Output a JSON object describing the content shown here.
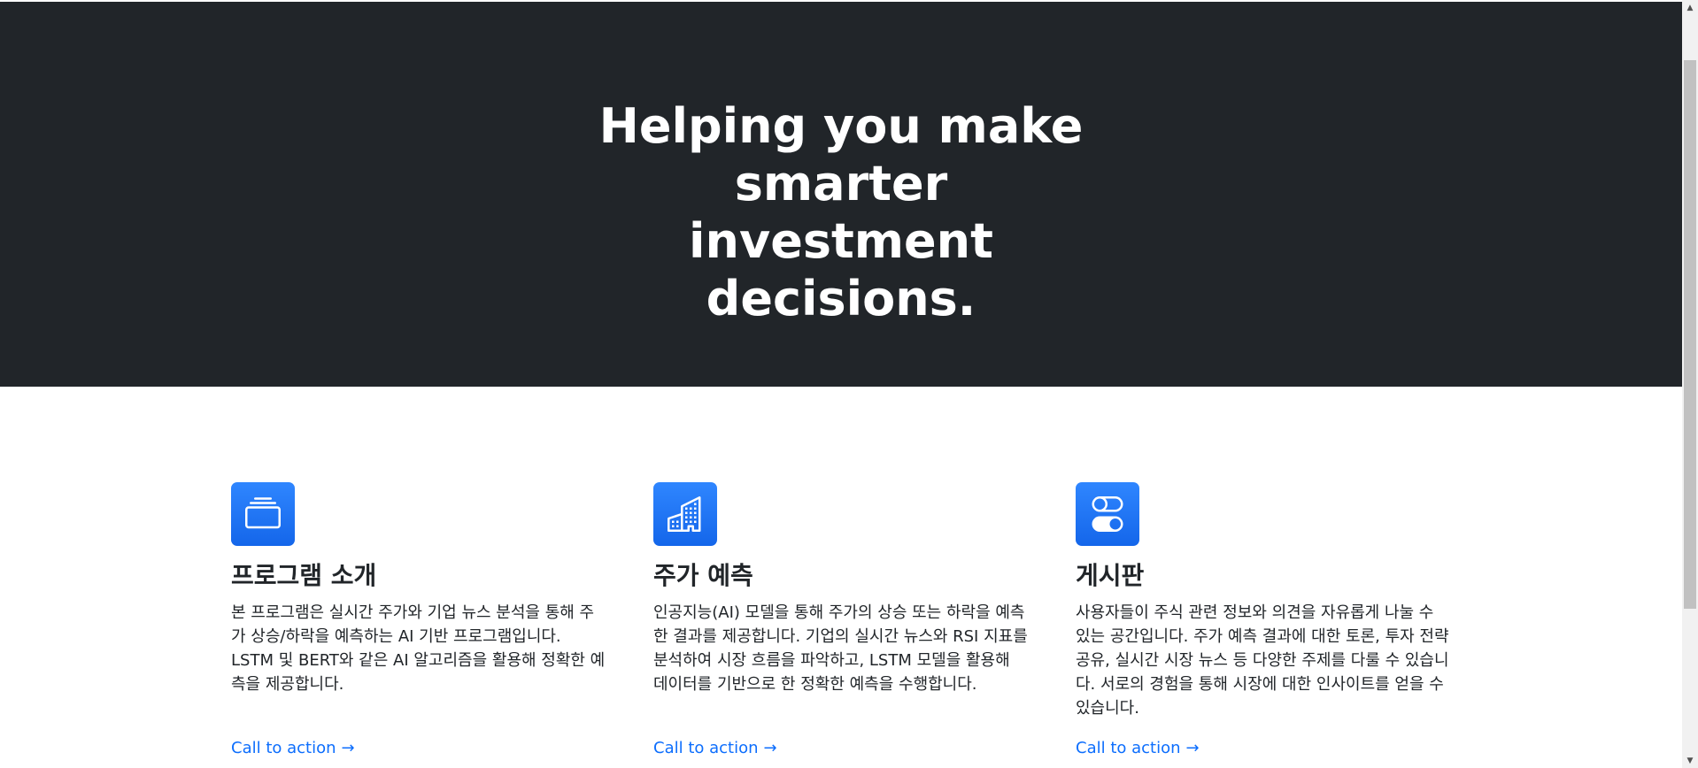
{
  "hero": {
    "title": "Helping you make smarter investment decisions."
  },
  "features": [
    {
      "icon": "collection-icon",
      "title": "프로그램 소개",
      "description": "본 프로그램은 실시간 주가와 기업 뉴스 분석을 통해 주가 상승/하락을 예측하는 AI 기반 프로그램입니다. LSTM 및 BERT와 같은 AI 알고리즘을 활용해 정확한 예측을 제공합니다.",
      "link_label": "Call to action",
      "link_arrow": "→"
    },
    {
      "icon": "building-icon",
      "title": "주가 예측",
      "description": "인공지능(AI) 모델을 통해 주가의 상승 또는 하락을 예측한 결과를 제공합니다. 기업의 실시간 뉴스와 RSI 지표를 분석하여 시장 흐름을 파악하고, LSTM 모델을 활용해 데이터를 기반으로 한 정확한 예측을 수행합니다.",
      "link_label": "Call to action",
      "link_arrow": "→"
    },
    {
      "icon": "toggles-icon",
      "title": "게시판",
      "description": "사용자들이 주식 관련 정보와 의견을 자유롭게 나눌 수 있는 공간입니다. 주가 예측 결과에 대한 토론, 투자 전략 공유, 실시간 시장 뉴스 등 다양한 주제를 다룰 수 있습니다. 서로의 경험을 통해 시장에 대한 인사이트를 얻을 수 있습니다.",
      "link_label": "Call to action",
      "link_arrow": "→"
    }
  ],
  "colors": {
    "hero_background": "#212529",
    "accent": "#0d6efd",
    "icon_background": "#1a73f0",
    "text": "#212529"
  }
}
